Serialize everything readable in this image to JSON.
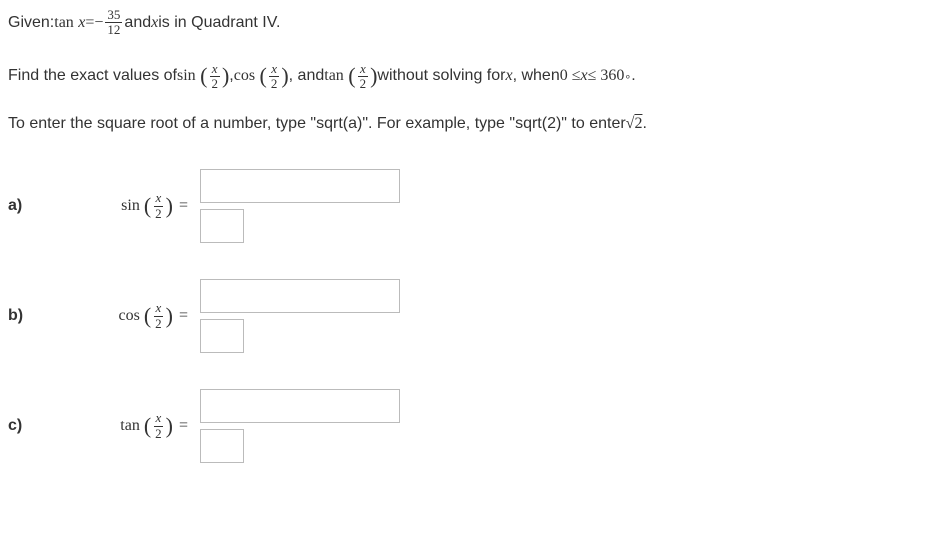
{
  "given": {
    "prefix": "Given: ",
    "tan": "tan",
    "x": "x",
    "equals": " = ",
    "minus": "−",
    "frac_num": "35",
    "frac_den": "12",
    "suffix": " and ",
    "suffix2": " is in Quadrant IV."
  },
  "find": {
    "prefix": "Find the exact values of ",
    "sin": "sin",
    "cos": "cos",
    "tan": "tan",
    "comma1": ", ",
    "comma2": ", and ",
    "suffix1": " without solving for ",
    "x": "x",
    "suffix2": ", when ",
    "ineq1": "0 ≤ ",
    "ineq2": " ≤ 360",
    "deg": "∘",
    "period": ".",
    "frac_num": "x",
    "frac_den": "2"
  },
  "instr": {
    "t1": "To enter the square root of a number, type \"sqrt(a)\". For example, type \"sqrt(2)\" to enter ",
    "sqrt": "√",
    "two": "2",
    "period": "."
  },
  "parts": {
    "a": {
      "label": "a)",
      "func": "sin"
    },
    "b": {
      "label": "b)",
      "func": "cos"
    },
    "c": {
      "label": "c)",
      "func": "tan"
    }
  },
  "common": {
    "half_num": "x",
    "half_den": "2",
    "equals": "="
  }
}
